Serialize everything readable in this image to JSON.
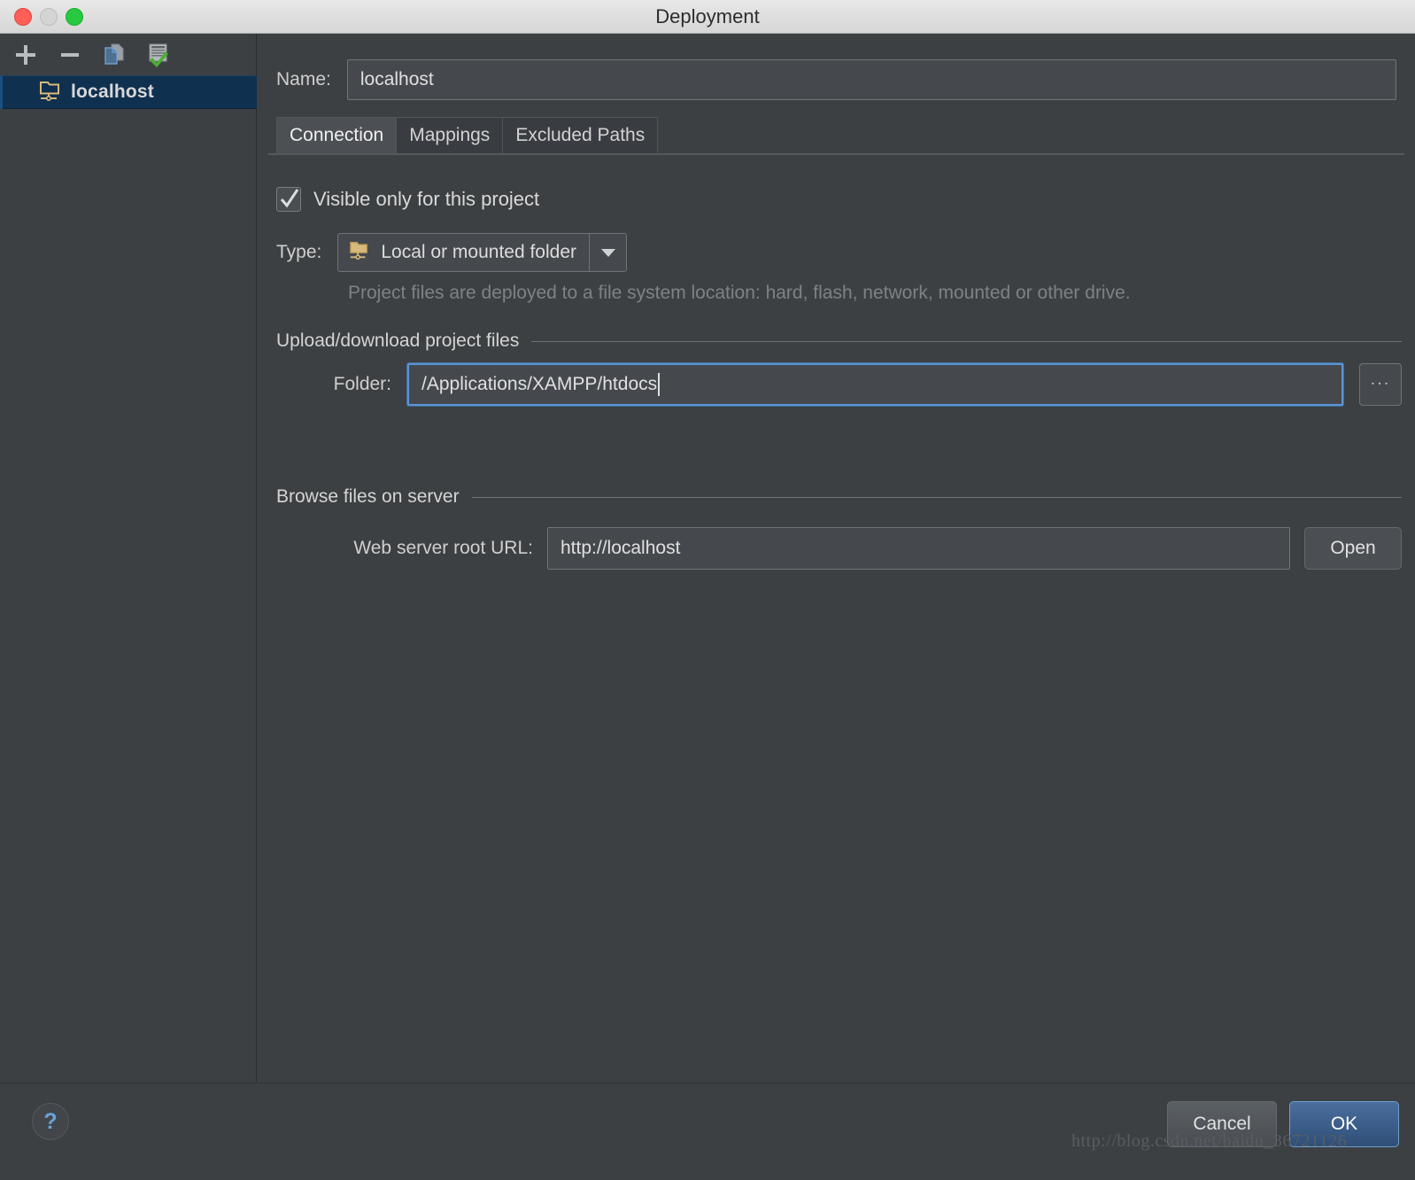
{
  "window": {
    "title": "Deployment",
    "traffic_lights": [
      "close-button",
      "minimize-button",
      "maximize-button"
    ]
  },
  "sidebar": {
    "toolbar": [
      {
        "name": "add-server-button",
        "icon": "plus-icon",
        "label": "+"
      },
      {
        "name": "remove-server-button",
        "icon": "minus-icon",
        "label": "−"
      },
      {
        "name": "copy-server-button",
        "icon": "copy-icon",
        "label": "Copy"
      },
      {
        "name": "set-default-server-button",
        "icon": "server-check-icon",
        "label": "Use as default"
      }
    ],
    "items": [
      {
        "label": "localhost",
        "icon": "folder-network-icon",
        "selected": true
      }
    ]
  },
  "form": {
    "name_label": "Name:",
    "name_value": "localhost"
  },
  "tabs": [
    {
      "label": "Connection",
      "active": true
    },
    {
      "label": "Mappings",
      "active": false
    },
    {
      "label": "Excluded Paths",
      "active": false
    }
  ],
  "connection": {
    "visible_only_label": "Visible only for this project",
    "visible_only_checked": true,
    "type_label": "Type:",
    "type_value": "Local or mounted folder",
    "type_icon": "folder-network-icon",
    "type_hint": "Project files are deployed to a file system location:  hard, flash, network, mounted or other drive.",
    "upload_section_title": "Upload/download project files",
    "folder_label": "Folder:",
    "folder_value": "/Applications/XAMPP/htdocs",
    "folder_browse_label": "...",
    "browse_section_title": "Browse files on server",
    "url_label": "Web server root URL:",
    "url_value": "http://localhost",
    "open_label": "Open"
  },
  "footer": {
    "help_label": "?",
    "cancel_label": "Cancel",
    "ok_label": "OK"
  },
  "watermark": "http://blog.csdn.net/baidu_36721126",
  "colors": {
    "window_bg": "#3c4043",
    "selected_row": "#10304f",
    "accent_blue": "#5c94d6",
    "ok_button": "#4a6e9e",
    "folder_icon": "#d7b97a",
    "check_green": "#4caf32"
  }
}
